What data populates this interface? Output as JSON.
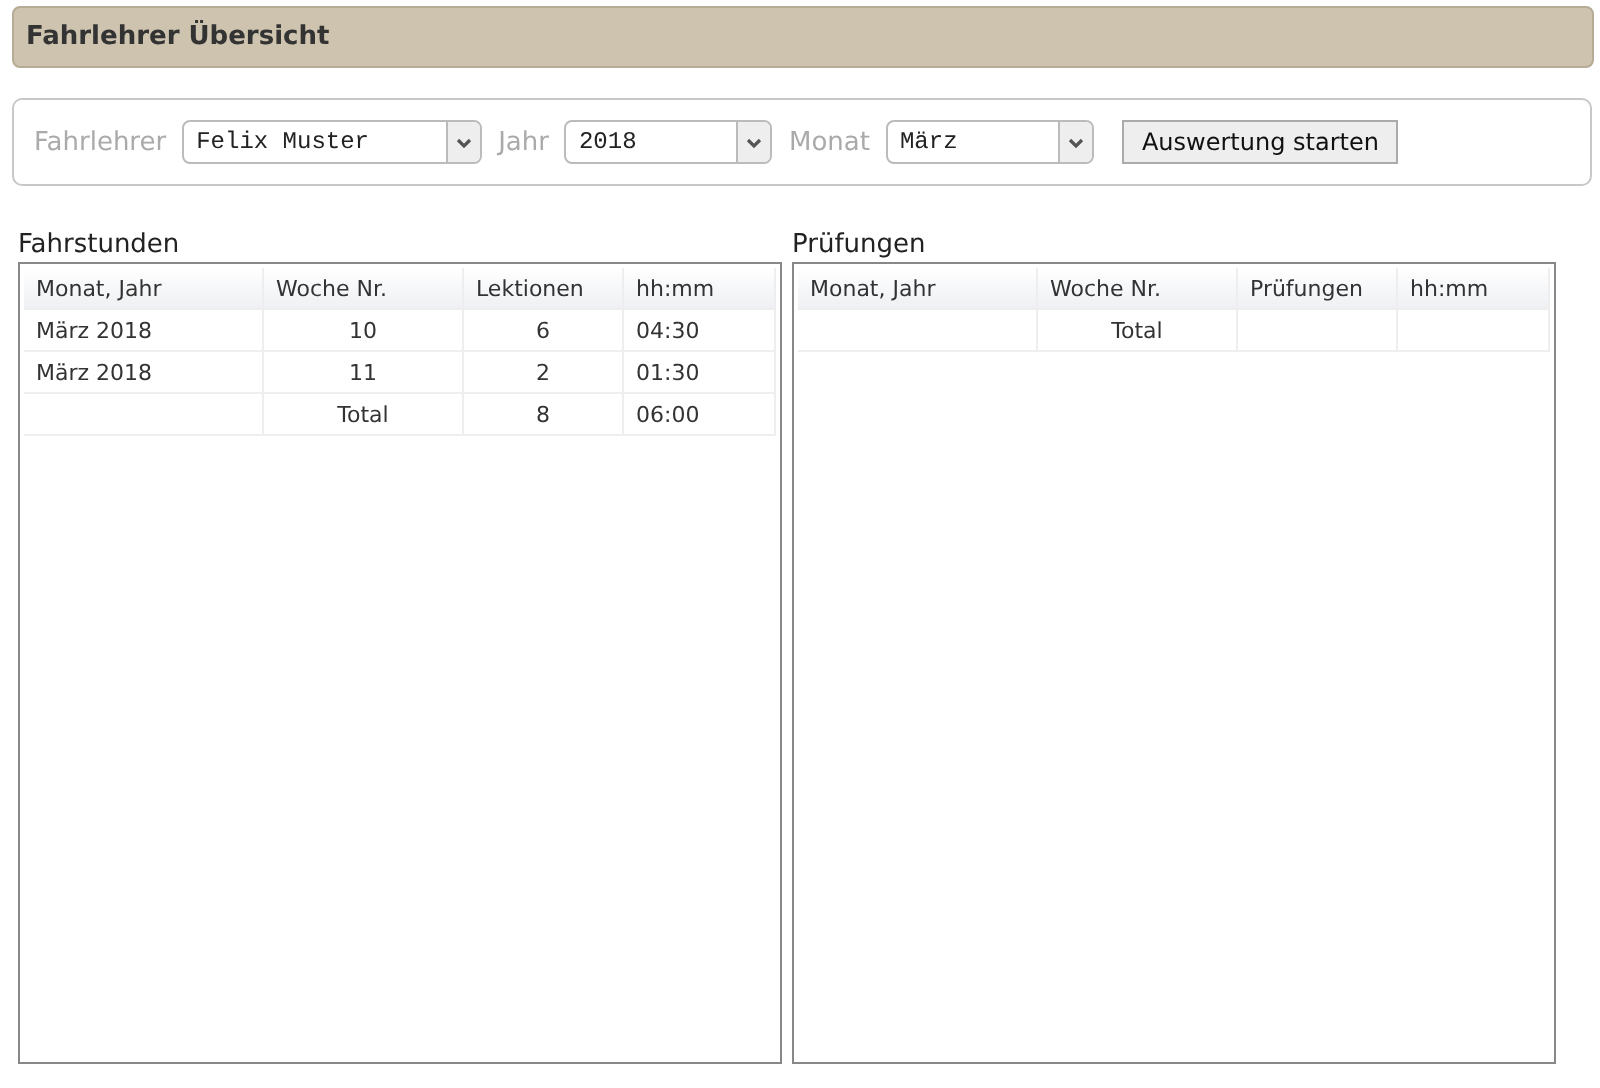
{
  "header": {
    "title": "Fahrlehrer Übersicht"
  },
  "filters": [
    {
      "label": "Fahrlehrer",
      "value": "Felix Muster",
      "kind": "wide"
    },
    {
      "label": "Jahr",
      "value": "2018",
      "kind": "medium"
    },
    {
      "label": "Monat",
      "value": "März",
      "kind": "narrow"
    }
  ],
  "action_button": "Auswertung starten",
  "tables": [
    {
      "title": "Fahrstunden",
      "columns": [
        "Monat, Jahr",
        "Woche Nr.",
        "Lektionen",
        "hh:mm"
      ],
      "rows": [
        [
          "März 2018",
          "10",
          "6",
          "04:30"
        ],
        [
          "März 2018",
          "11",
          "2",
          "01:30"
        ],
        [
          "",
          "Total",
          "8",
          "06:00"
        ]
      ]
    },
    {
      "title": "Prüfungen",
      "columns": [
        "Monat, Jahr",
        "Woche Nr.",
        "Prüfungen",
        "hh:mm"
      ],
      "rows": [
        [
          "",
          "Total",
          "",
          ""
        ]
      ]
    }
  ]
}
